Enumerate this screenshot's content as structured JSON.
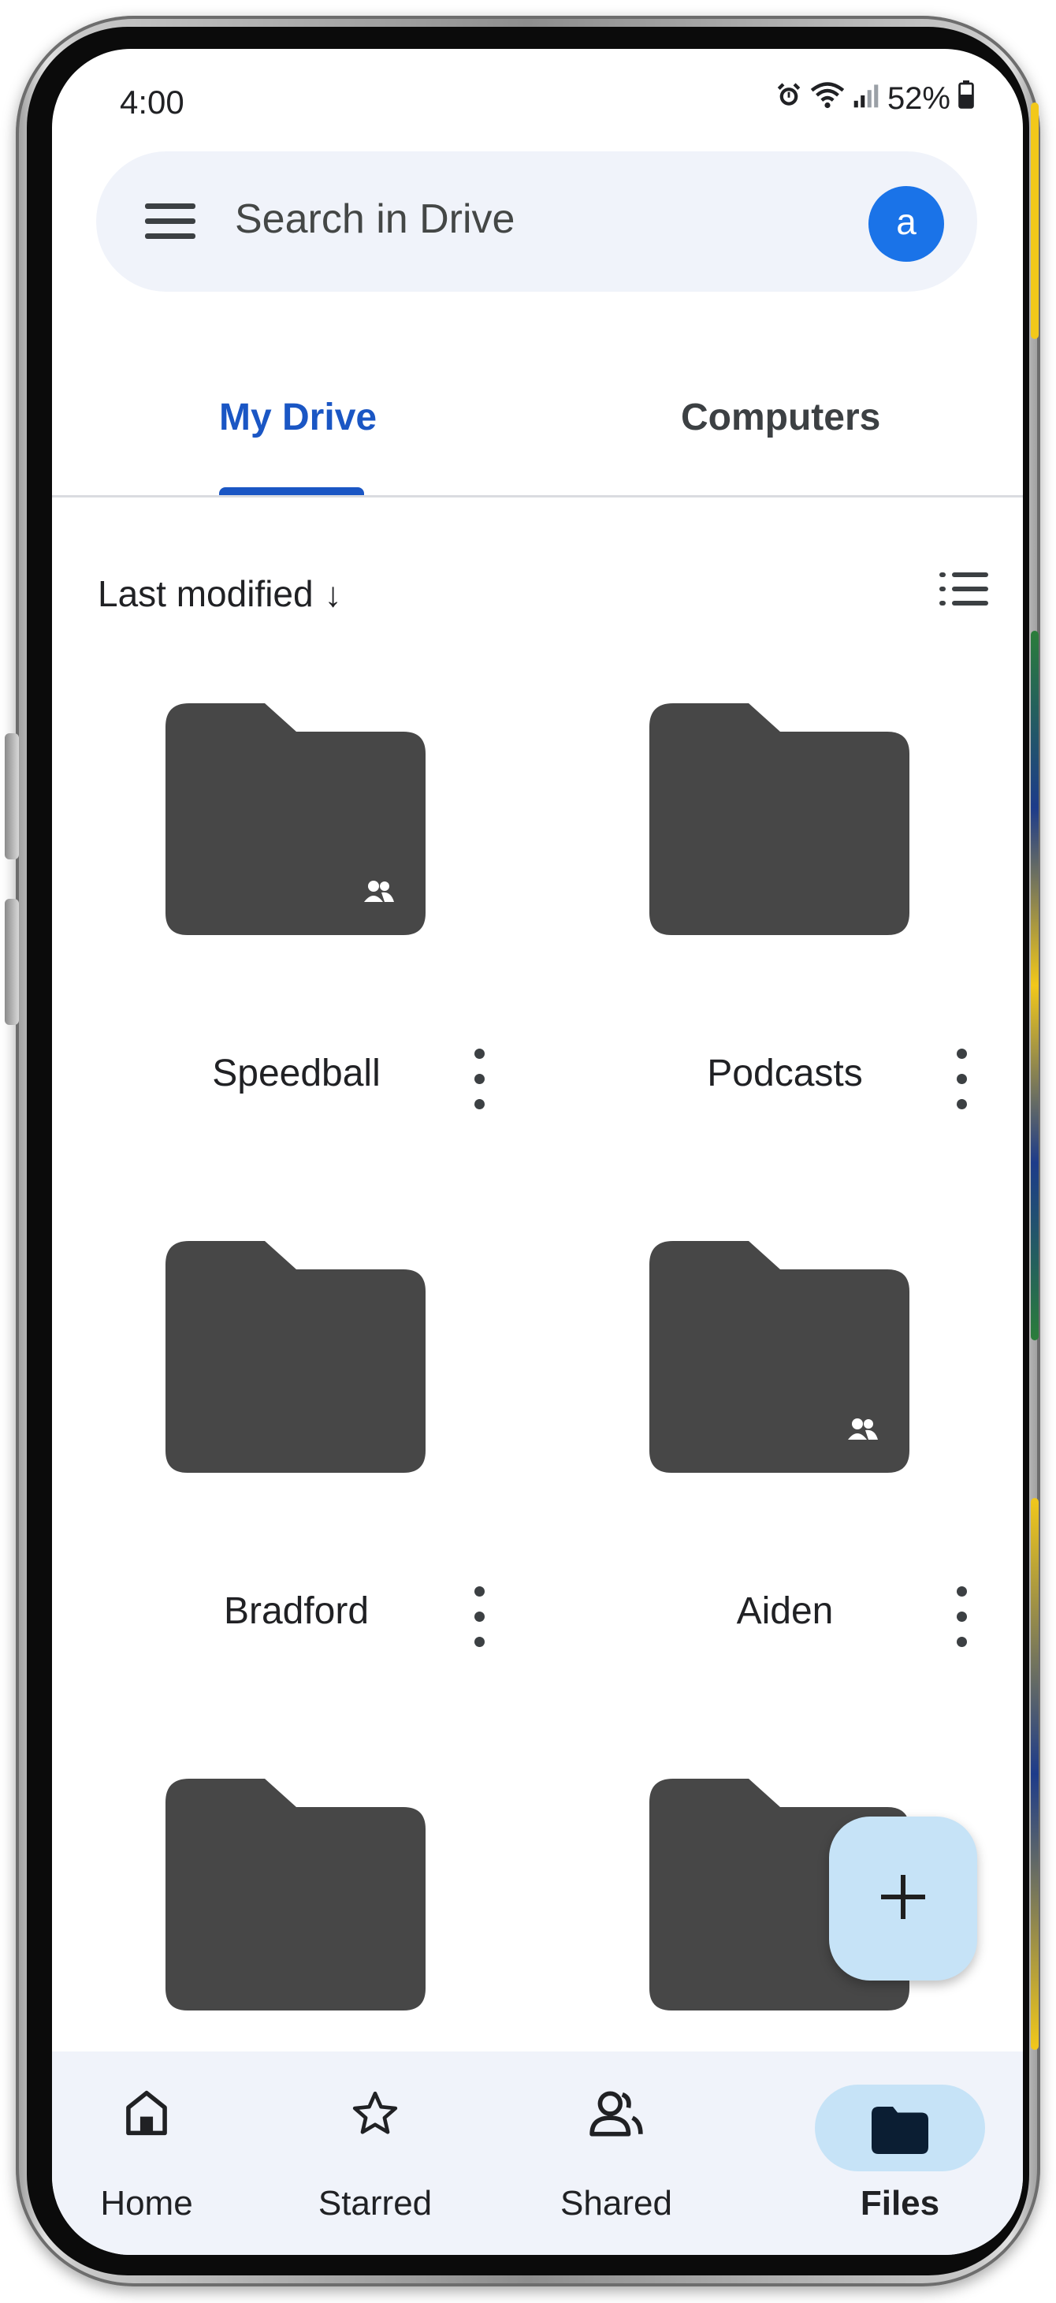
{
  "status_bar": {
    "time": "4:00",
    "battery": "52%"
  },
  "search": {
    "placeholder": "Search in Drive",
    "avatar_letter": "a"
  },
  "tabs": [
    {
      "label": "My Drive"
    },
    {
      "label": "Computers"
    }
  ],
  "sort": {
    "label": "Last modified",
    "arrow": "↓"
  },
  "folders": [
    {
      "name": "Speedball",
      "shared": true
    },
    {
      "name": "Podcasts",
      "shared": false
    },
    {
      "name": "Bradford",
      "shared": false
    },
    {
      "name": "Aiden",
      "shared": true
    }
  ],
  "fab": {
    "icon": "plus-icon"
  },
  "bottom_nav": [
    {
      "label": "Home",
      "icon": "home-icon"
    },
    {
      "label": "Starred",
      "icon": "star-icon"
    },
    {
      "label": "Shared",
      "icon": "people-icon"
    },
    {
      "label": "Files",
      "icon": "folder-icon",
      "active": true
    }
  ],
  "colors": {
    "accent": "#1a56c4",
    "folder": "#474747",
    "fab": "#c6e3f7",
    "nav_bg": "#f0f3fa",
    "avatar": "#1a73e8"
  }
}
